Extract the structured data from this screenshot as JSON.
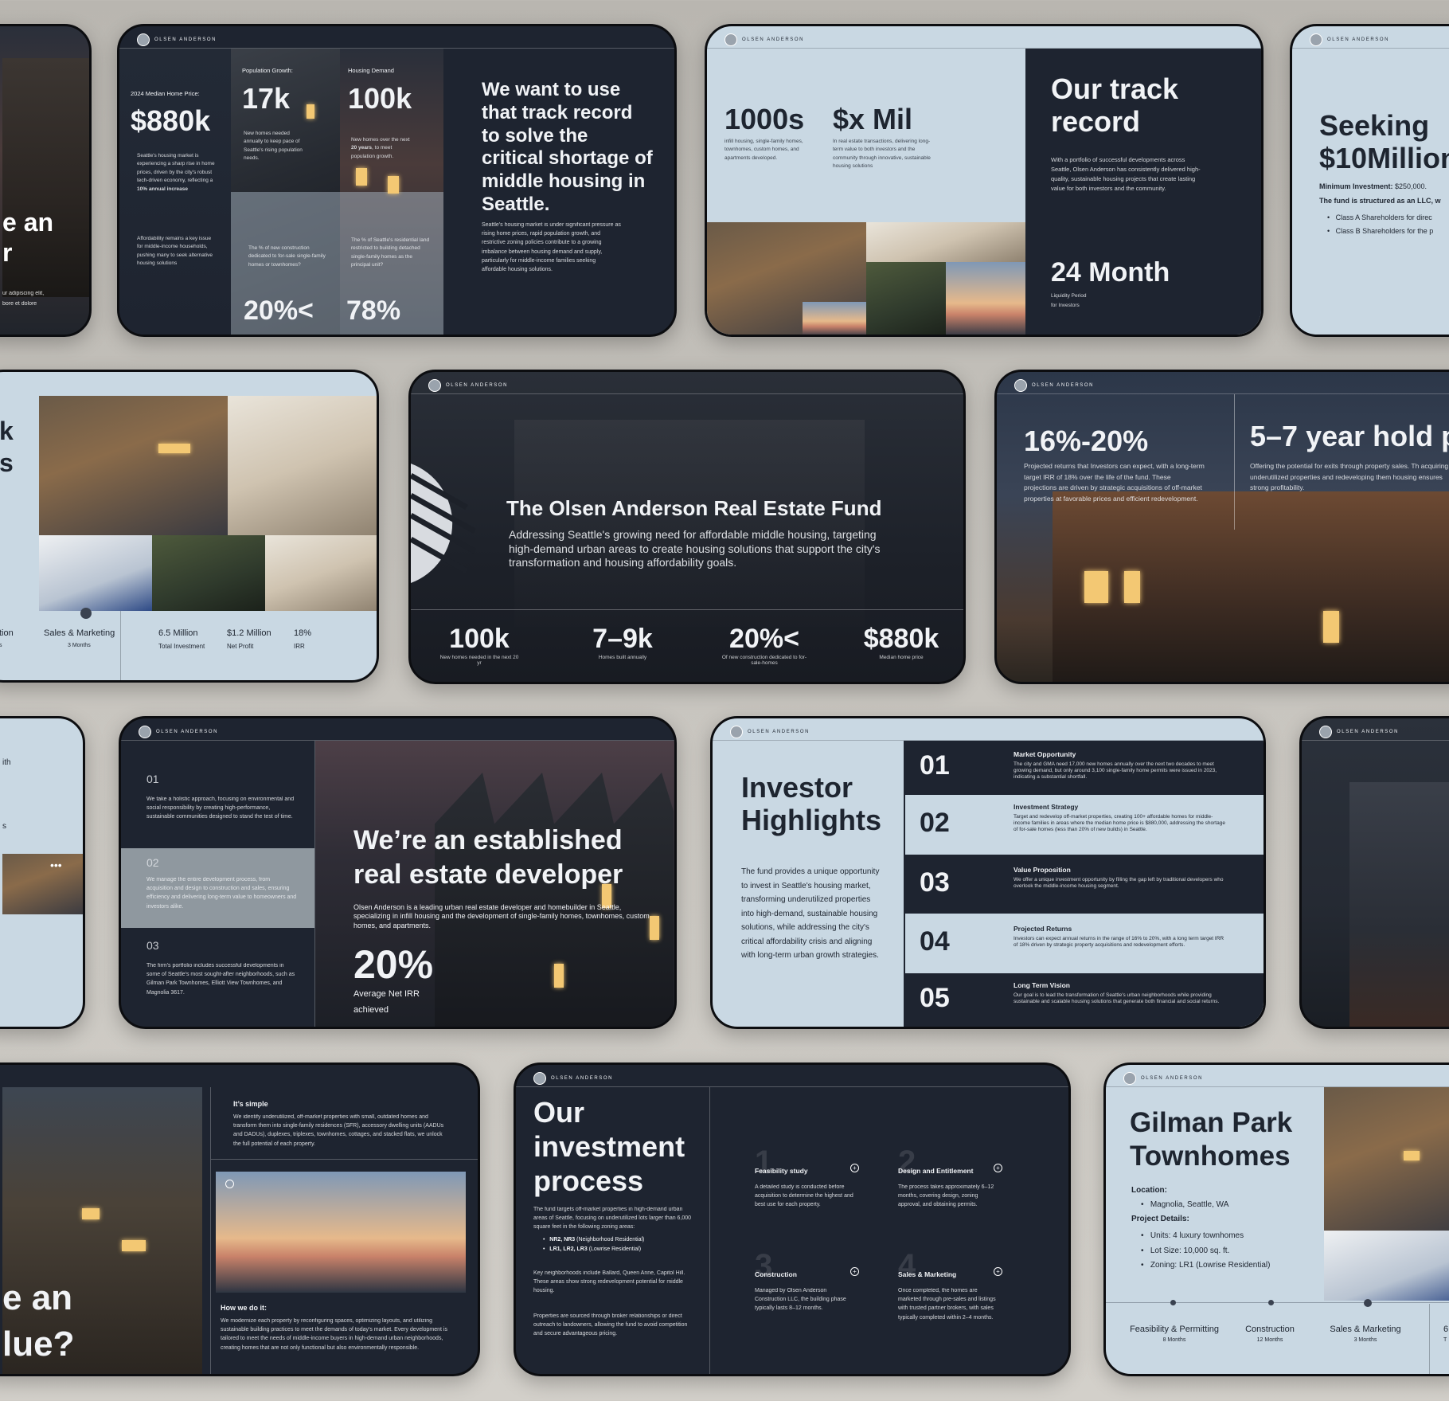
{
  "brand": "OLSEN ANDERSON",
  "colors": {
    "background": "#c2bfb9",
    "slide_dark": "#1e2430",
    "slide_light": "#c9d8e3",
    "text_light": "#f1f3f6",
    "text_dark": "#1e2530"
  },
  "s1": {
    "frag_a": "e an",
    "frag_b": "r",
    "frag_p1": "ur adipiscing elit,",
    "frag_p2": "bore et dolore"
  },
  "s2": {
    "c1_label": "2024 Median Home Price:",
    "c1_value": "$880k",
    "c1_p1a": "Seattle's housing market is experiencing a sharp rise in home prices, driven by the city's robust tech-driven economy, reflecting a ",
    "c1_p1b": "10% annual increase",
    "c1_p2": "Affordability remains a key issue for middle-income households, pushing many to seek alternative housing solutions",
    "c2_label": "Population Growth:",
    "c2_value": "17k",
    "c2_p": "New homes needed annually to keep pace of Seattle's rising population needs.",
    "c2_q": "The % of new construction dedicated to for-sale single-family homes or townhomes?",
    "c2_stat": "20%<",
    "c3_label": "Housing Demand",
    "c3_value": "100k",
    "c3_pa": "New homes over the next ",
    "c3_pb": "20 years",
    "c3_pc": ", to meet population growth.",
    "c3_q": "The % of Seattle's residential land restricted to building detached single-family homes as the principal unit?",
    "c3_stat": "78%",
    "heading": "We want to use that track record to solve the critical shortage of middle housing in Seattle.",
    "body": "Seattle's housing market is under significant pressure as rising home prices, rapid population growth, and restrictive zoning policies contribute to a growing imbalance between housing demand and supply, particularly for middle-income families seeking affordable housing solutions."
  },
  "s3": {
    "v1": "1000s",
    "p1": "infill housing, single-family homes, townhomes, custom homes, and apartments developed.",
    "v2": "$x Mil",
    "p2": "In real estate transactions, delivering long-term value to both investors and the community through innovative, sustainable housing solutions",
    "title": "Our track record",
    "body": "With a portfolio of successful developments across Seattle, Olsen Anderson has consistently delivered high-quality, sustainable housing projects that create lasting value for both investors and the community.",
    "v3": "24 Month",
    "p3a": "Liquidity Period",
    "p3b": "for Investors"
  },
  "s4": {
    "title": "Seeking $10Million",
    "min_label": "Minimum Investment:",
    "min_value": " $250,000.",
    "struct": "The fund is structured as an LLC, w",
    "items": [
      "Class A Shareholders for direc",
      "Class B Shareholders for the p"
    ]
  },
  "s5": {
    "frag_a": "k",
    "frag_b": "s",
    "s1_name": "tion",
    "s1_sub": "s",
    "s2_name": "Sales & Marketing",
    "s2_sub": "3 Months",
    "st1_v": "6.5 Million",
    "st1_l": "Total Investment",
    "st2_v": "$1.2 Million",
    "st2_l": "Net Profit",
    "st3_v": "18%",
    "st3_l": "IRR"
  },
  "s6": {
    "title": "The Olsen Anderson Real Estate Fund",
    "sub": "Addressing Seattle's growing need for affordable middle housing, targeting high-demand urban areas to create housing solutions that support the city's transformation and housing affordability goals.",
    "stats": [
      {
        "value": "100k",
        "label": "New homes needed in the next 20 yr"
      },
      {
        "value": "7–9k",
        "label": "Homes built annually"
      },
      {
        "value": "20%<",
        "label": "Of new construction dedicated to for-sale-homes"
      },
      {
        "value": "$880k",
        "label": "Median home price"
      }
    ]
  },
  "s7": {
    "v1": "16%-20%",
    "p1": "Projected returns that Investors can expect, with a long-term target IRR of 18% over the life of the fund. These projections are driven by strategic acquisitions of off-market properties at favorable prices and efficient redevelopment.",
    "v2": "5–7 year hold p",
    "p2": "Offering the potential for exits through property sales. Th acquiring underutilized properties and redeveloping them housing ensures strong profitability."
  },
  "s8": {
    "frag_a": "ith",
    "frag_b": "s",
    "dots": "•••"
  },
  "s9": {
    "items": [
      {
        "num": "01",
        "text": "We take a holistic approach, focusing on environmental and social responsibility by creating high-performance, sustainable communities designed to stand the test of time."
      },
      {
        "num": "02",
        "text": "We manage the entire development process, from acquisition and design to construction and sales, ensuring efficiency and delivering long-term value to homeowners and investors alike."
      },
      {
        "num": "03",
        "text": "The firm's portfolio includes successful developments in some of Seattle's most sought-after neighborhoods, such as Gilman Park Townhomes, Elliott View Townhomes, and Magnolia 3617."
      }
    ],
    "heading": "We’re an established real estate developer",
    "body": "Olsen Anderson is a leading urban real estate developer and homebuilder in Seattle, specializing in infill housing and the development of single-family homes, townhomes, custom homes, and apartments.",
    "stat": "20%",
    "stat_l1": "Average Net IRR",
    "stat_l2": "achieved"
  },
  "s10": {
    "title": "Investor Highlights",
    "body": "The fund provides a unique opportunity to invest in Seattle's housing market, transforming underutilized properties into high-demand, sustainable housing solutions, while addressing the city's critical affordability crisis and aligning with long-term urban growth strategies.",
    "rows": [
      {
        "num": "01",
        "title": "Market Opportunity",
        "text": "The city and GMA need 17,000 new homes annually over the next two decades to meet growing demand, but only around 3,100 single-family home permits were issued in 2023, indicating a substantial shortfall."
      },
      {
        "num": "02",
        "title": "Investment Strategy",
        "text": "Target and redevelop off-market properties, creating 100+ affordable homes for middle-income families in areas where the median home price is $880,000, addressing the shortage of for-sale homes (less than 20% of new builds) in Seattle."
      },
      {
        "num": "03",
        "title": "Value Proposition",
        "text": "We offer a unique investment opportunity by filling the gap left by traditional developers who overlook the middle-income housing segment."
      },
      {
        "num": "04",
        "title": "Projected Returns",
        "text": "Investors can expect annual returns in the range of 16% to 20%, with a long term target IRR of 18% driven by strategic property acquisitions and redevelopment efforts."
      },
      {
        "num": "05",
        "title": "Long Term Vision",
        "text": "Our goal is to lead the transformation of Seattle's urban neighborhoods while providing sustainable and scalable housing solutions that generate both financial and social returns."
      }
    ]
  },
  "s12": {
    "frag_a": "e an",
    "frag_b": "lue?",
    "h1": "It’s simple",
    "p1": "We identify underutilized, off-market properties with small, outdated homes and transform them into single-family residences (SFR), accessory dwelling units (AADUs and DADUs), duplexes, triplexes, townhomes, cottages, and stacked flats, we unlock the full potential of each property.",
    "h2": "How we do it:",
    "p2": "We modernize each property by reconfiguring spaces, optimizing layouts, and utilizing sustainable building practices to meet the demands of today's market. Every development is tailored to meet the needs of middle-income buyers in high-demand urban neighborhoods, creating homes that are not only functional but also environmentally responsible."
  },
  "s13": {
    "title": "Our investment process",
    "p1": "The fund targets off-market properties in high-demand urban areas of Seattle, focusing on underutilized lots larger than 6,000 square feet in the following zoning areas:",
    "z1a": "NR2, NR3",
    "z1b": " (Neighborhood Residential)",
    "z2a": "LR1, LR2, LR3",
    "z2b": " (Lowrise Residential)",
    "p2": "Key neighborhoods include Ballard, Queen Anne, Capitol Hill. These areas show strong redevelopment potential for middle housing.",
    "p3": "Properties are sourced through broker relationships or direct outreach to landowners, allowing the fund to avoid competition and secure advantageous pricing.",
    "steps": [
      {
        "n": "1",
        "title": "Feasibility study",
        "text": "A detailed study is conducted before acquisition to determine the highest and best use for each property."
      },
      {
        "n": "2",
        "title": "Design and Entitlement",
        "text": "The process takes approximately 6–12 months, covering design, zoning approval, and obtaining permits."
      },
      {
        "n": "3",
        "title": "Construction",
        "text": "Managed by Olsen Anderson Construction LLC, the building phase typically lasts 8–12 months."
      },
      {
        "n": "4",
        "title": "Sales & Marketing",
        "text": "Once completed, the homes are marketed through pre-sales and listings with trusted partner brokers, with sales typically completed within 2–4 months."
      }
    ]
  },
  "s14": {
    "title": "Gilman Park Townhomes",
    "loc_label": "Location:",
    "loc": "Magnolia, Seattle, WA",
    "det_label": "Project Details:",
    "details": [
      "Units: 4 luxury townhomes",
      "Lot Size: 10,000 sq. ft.",
      "Zoning: LR1 (Lowrise Residential)"
    ],
    "t1": "Feasibility & Permitting",
    "t1s": "8 Months",
    "t2": "Construction",
    "t2s": "12 Months",
    "t3": "Sales & Marketing",
    "t3s": "3 Months",
    "t4": "6",
    "t4s": "T"
  }
}
